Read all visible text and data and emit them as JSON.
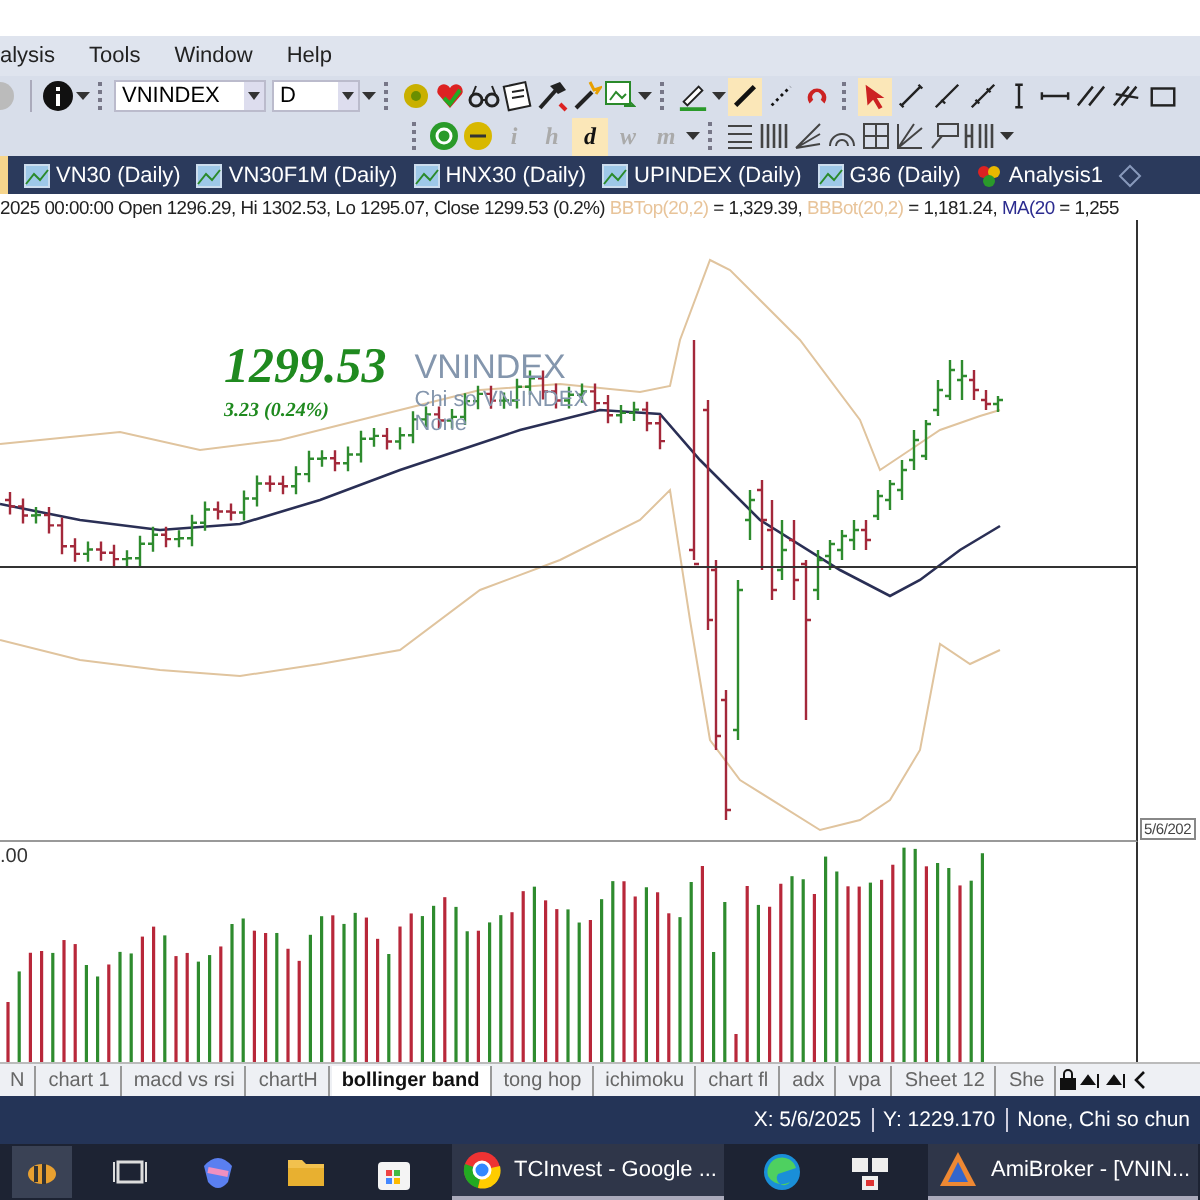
{
  "menu": [
    "alysis",
    "Tools",
    "Window",
    "Help"
  ],
  "toolbar": {
    "symbol": "VNINDEX",
    "interval": "D",
    "tools": [
      {
        "kind": "pen",
        "selected": false
      },
      {
        "kind": "line",
        "selected": true
      },
      {
        "kind": "dotted",
        "selected": false
      },
      {
        "kind": "magnet",
        "selected": false
      },
      {
        "kind": "cursor",
        "selected": true
      },
      {
        "kind": "segment",
        "selected": false
      },
      {
        "kind": "ray",
        "selected": false
      },
      {
        "kind": "extended",
        "selected": false
      },
      {
        "kind": "vertical",
        "selected": false
      },
      {
        "kind": "horizontal",
        "selected": false
      },
      {
        "kind": "parallel",
        "selected": false
      },
      {
        "kind": "channel",
        "selected": false
      },
      {
        "kind": "rect",
        "selected": false
      }
    ],
    "intervals": [
      {
        "label": "i",
        "selected": false
      },
      {
        "label": "h",
        "selected": false
      },
      {
        "label": "d",
        "selected": true
      },
      {
        "label": "w",
        "selected": false
      },
      {
        "label": "m",
        "selected": false
      }
    ]
  },
  "chart_tabs": [
    {
      "label": "VN30 (Daily)",
      "kind": "chart"
    },
    {
      "label": "VN30F1M (Daily)",
      "kind": "chart"
    },
    {
      "label": "HNX30 (Daily)",
      "kind": "chart"
    },
    {
      "label": "UPINDEX (Daily)",
      "kind": "chart"
    },
    {
      "label": "G36 (Daily)",
      "kind": "chart"
    },
    {
      "label": "Analysis1",
      "kind": "analysis"
    }
  ],
  "info_line": [
    {
      "text": "2025 00:00:00 Open 1296.29, Hi 1302.53, Lo 1295.07, Close 1299.53 (0.2%)",
      "color": "#222222"
    },
    {
      "text": "BBTop(20,2)",
      "color": "#e8c49a"
    },
    {
      "text": "= 1,329.39,",
      "color": "#222222"
    },
    {
      "text": "BBBot(20,2)",
      "color": "#e8c49a"
    },
    {
      "text": "= 1,181.24,",
      "color": "#222222"
    },
    {
      "text": "MA(20",
      "color": "#2b2b8f"
    },
    {
      "text": "= 1,255",
      "color": "#222222"
    }
  ],
  "chart_title": {
    "price": "1299.53",
    "change": "3.23 (0.24%)",
    "symbol": "VNINDEX",
    "name": "Chi so VN-INDEX",
    "group": "None"
  },
  "axis_date": "5/6/202",
  "volume_label": ".00",
  "sheet_tabs": [
    {
      "label": "N",
      "selected": false
    },
    {
      "label": "chart 1",
      "selected": false
    },
    {
      "label": "macd vs rsi",
      "selected": false
    },
    {
      "label": "chartH",
      "selected": false
    },
    {
      "label": "bollinger band",
      "selected": true
    },
    {
      "label": "tong hop",
      "selected": false
    },
    {
      "label": "ichimoku",
      "selected": false
    },
    {
      "label": "chart fl",
      "selected": false
    },
    {
      "label": "adx",
      "selected": false
    },
    {
      "label": "vpa",
      "selected": false
    },
    {
      "label": "Sheet 12",
      "selected": false
    },
    {
      "label": "She",
      "selected": false
    }
  ],
  "status_bar": [
    "X: 5/6/2025",
    "Y: 1229.170",
    "None, Chi so chun"
  ],
  "taskbar": [
    {
      "kind": "app"
    },
    {
      "kind": "icon"
    },
    {
      "kind": "icon"
    },
    {
      "kind": "icon"
    },
    {
      "kind": "icon"
    },
    {
      "kind": "window",
      "label": "TCInvest - Google ..."
    },
    {
      "kind": "icon"
    },
    {
      "kind": "icon"
    },
    {
      "kind": "window",
      "label": "AmiBroker - [VNIN..."
    }
  ]
}
